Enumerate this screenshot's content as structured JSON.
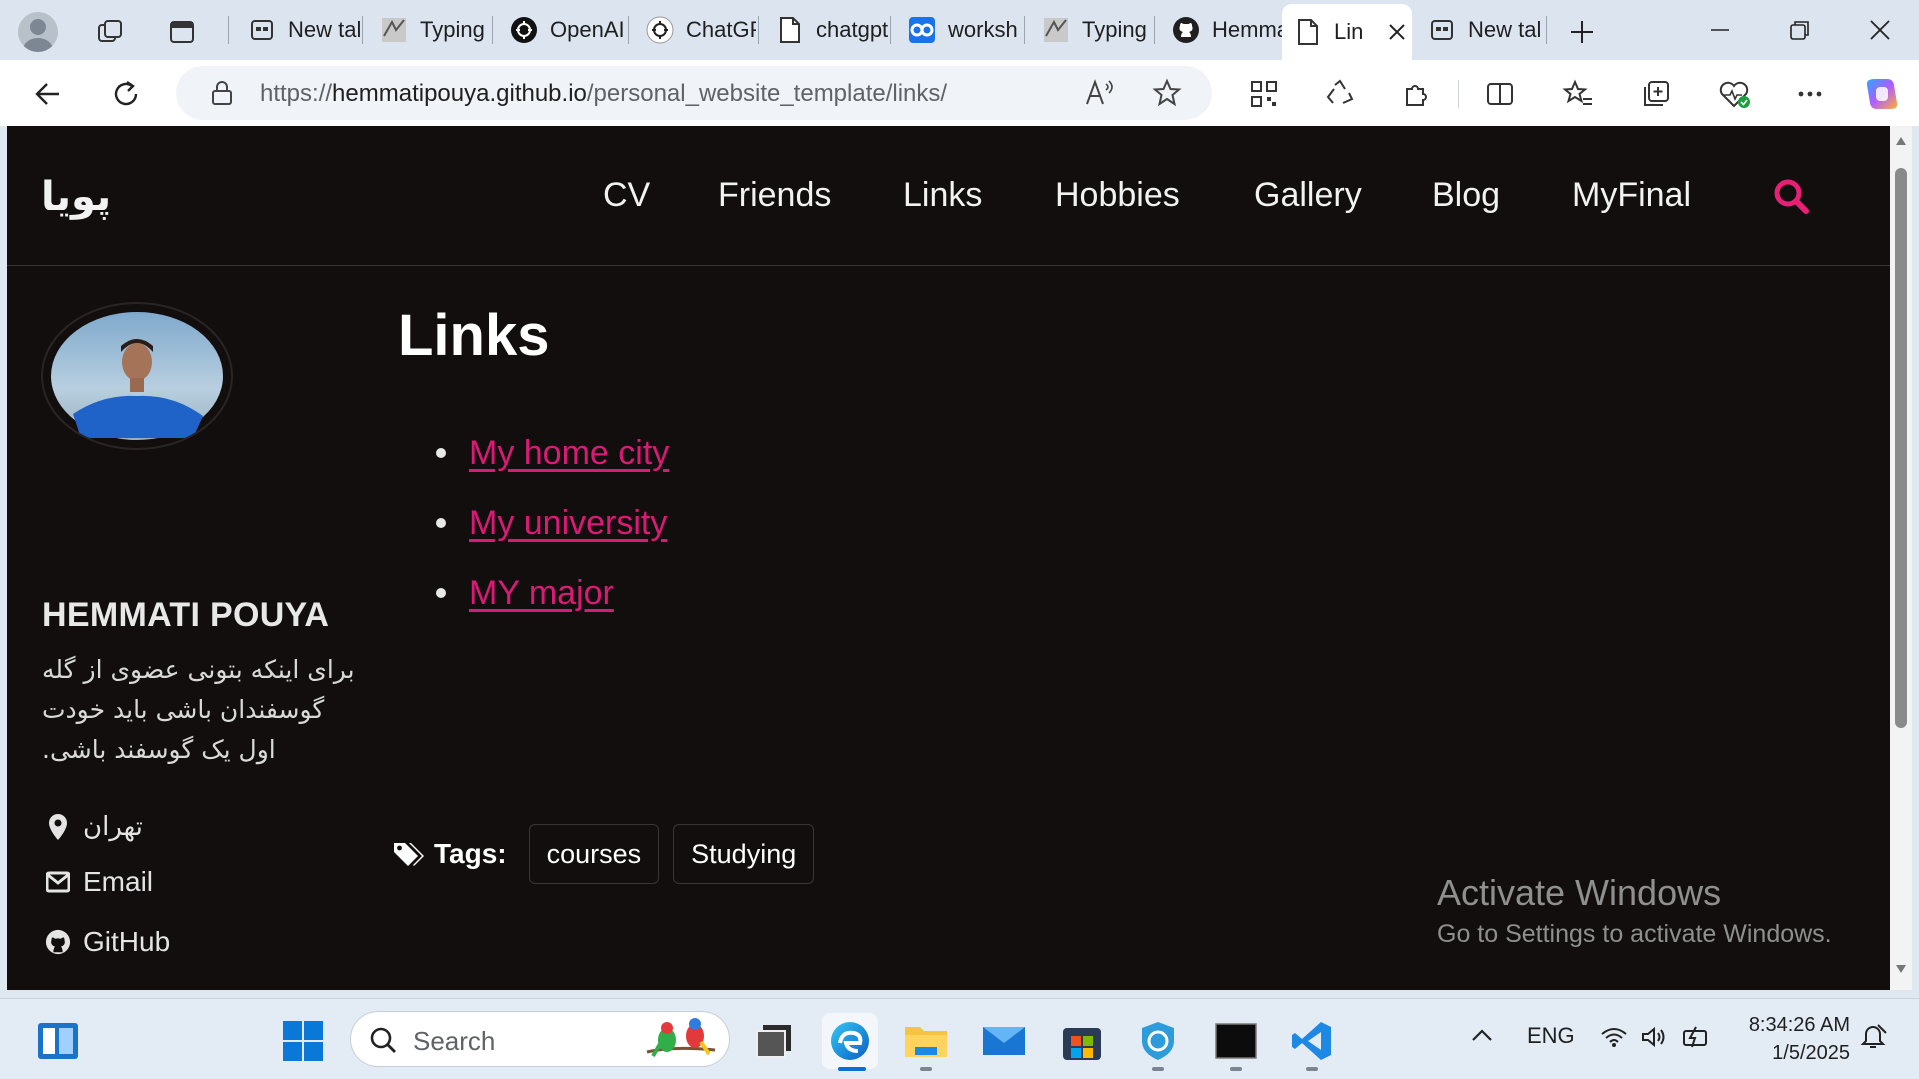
{
  "browser": {
    "tabs": [
      {
        "label": "",
        "icon": "profile-icon"
      },
      {
        "label": "",
        "icon": "workspaces-icon"
      },
      {
        "label": "",
        "icon": "vertical-tabs-icon"
      },
      {
        "label": "New tal",
        "icon": "newtab-icon"
      },
      {
        "label": "Typing",
        "icon": "typing-site-icon"
      },
      {
        "label": "OpenAI",
        "icon": "openai-icon"
      },
      {
        "label": "ChatGP",
        "icon": "chatgpt-icon"
      },
      {
        "label": "chatgpt",
        "icon": "page-icon"
      },
      {
        "label": "worksh",
        "icon": "colab-icon"
      },
      {
        "label": "Typing",
        "icon": "typing-site-icon"
      },
      {
        "label": "Hemma",
        "icon": "github-icon"
      },
      {
        "label": "Lin",
        "icon": "page-icon",
        "active": true
      },
      {
        "label": "New tal",
        "icon": "newtab-icon"
      }
    ],
    "url_prefix": "https://",
    "url_host": "hemmatipouya.github.io",
    "url_path": "/personal_website_template/links/"
  },
  "site": {
    "title": "پویا",
    "nav": [
      "CV",
      "Friends",
      "Links",
      "Hobbies",
      "Gallery",
      "Blog",
      "MyFinal"
    ],
    "accent": "#e91e75"
  },
  "author": {
    "name": "HEMMATI POUYA",
    "bio": "برای اینکه بتونی عضوی از گله گوسفندان باشی باید خودت اول یک گوسفند باشی.",
    "location": "تهران",
    "email_label": "Email",
    "github_label": "GitHub"
  },
  "page": {
    "title": "Links",
    "links": [
      "My home city",
      "My university",
      "MY major"
    ],
    "tags_label": "Tags:",
    "tags": [
      "courses",
      "Studying"
    ]
  },
  "watermark": {
    "line1": "Activate Windows",
    "line2": "Go to Settings to activate Windows."
  },
  "taskbar": {
    "search_label": "Search",
    "lang": "ENG",
    "time": "8:34:26 AM",
    "date": "1/5/2025"
  }
}
